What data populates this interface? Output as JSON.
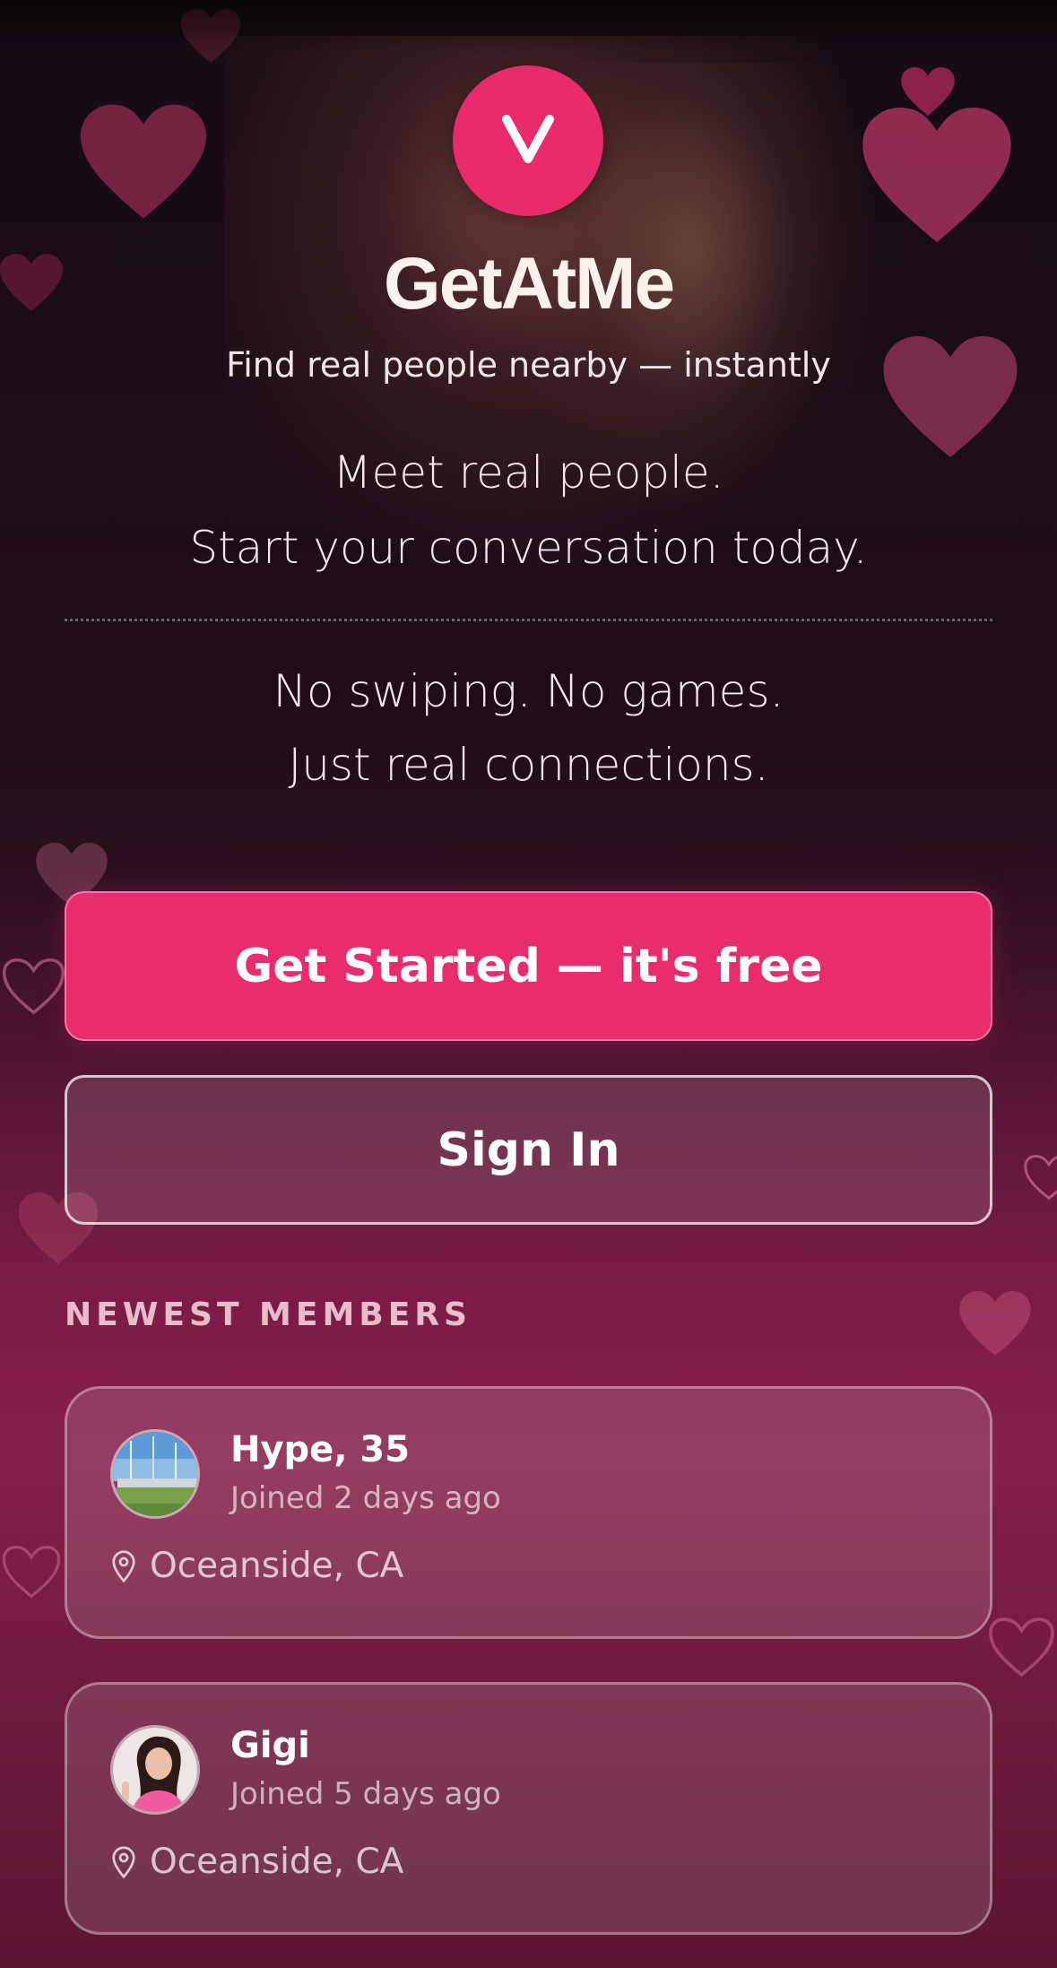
{
  "app": {
    "title": "GetAtMe",
    "tagline": "Find real people nearby — instantly",
    "logo_letter": "V",
    "accent_color": "#e92c6d"
  },
  "hero": {
    "line1": "Meet real people.",
    "line2": "Start your conversation today.",
    "line3": "No swiping. No games.",
    "line4": "Just real connections."
  },
  "actions": {
    "get_started": "Get Started — it's free",
    "sign_in": "Sign In"
  },
  "newest_members": {
    "title": "NEWEST MEMBERS",
    "members": [
      {
        "name": "Hype, 35",
        "joined": "Joined 2 days ago",
        "location": "Oceanside, CA",
        "avatar": "marina-photo"
      },
      {
        "name": "Gigi",
        "joined": "Joined 5 days ago",
        "location": "Oceanside, CA",
        "avatar": "woman-pink-photo"
      }
    ]
  }
}
